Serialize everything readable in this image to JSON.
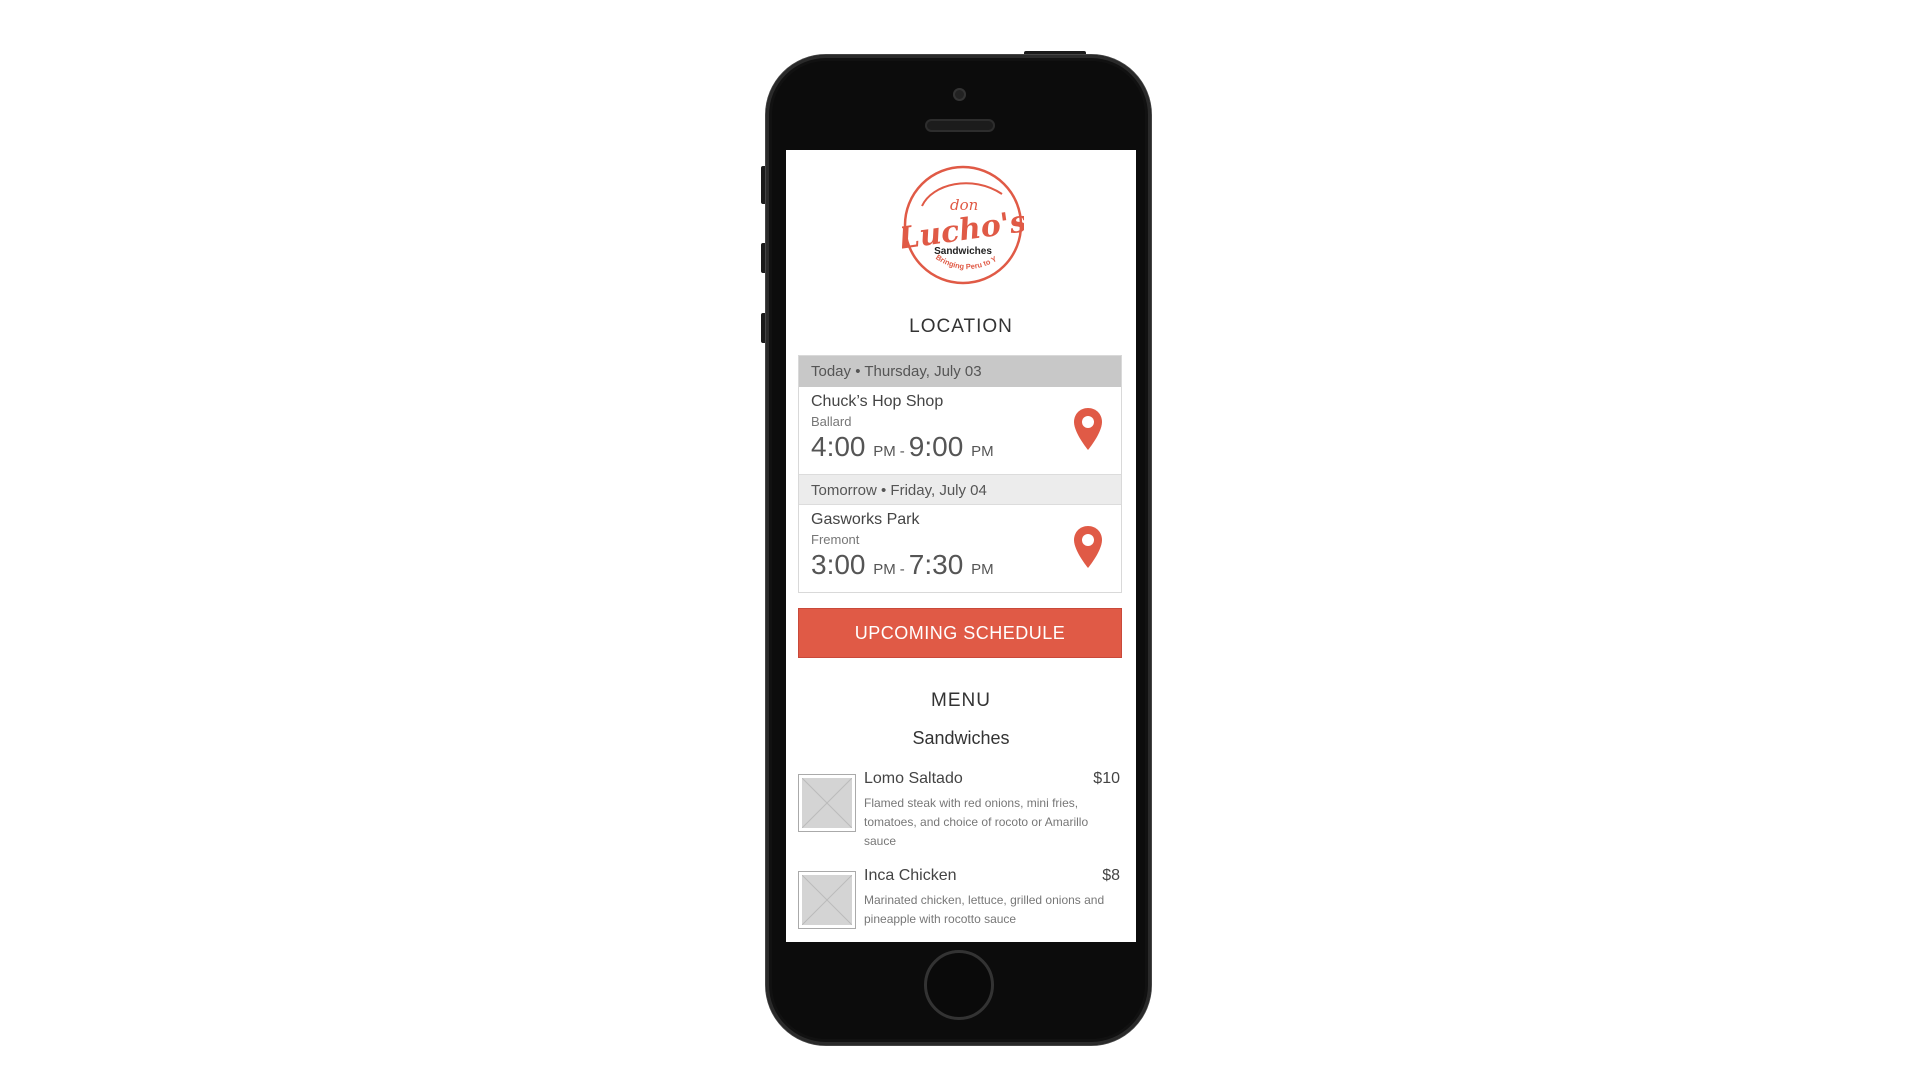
{
  "brand": {
    "logo_top": "don",
    "logo_main": "Lucho's",
    "logo_sub": "Sandwiches",
    "logo_tagline": "Bringing Peru to You",
    "accent_color": "#e05a46"
  },
  "location": {
    "title": "LOCATION",
    "days": [
      {
        "header": "Today • Thursday, July 03",
        "place": "Chuck’s Hop Shop",
        "area": "Ballard",
        "start": "4:00",
        "start_ampm": "PM",
        "end": "9:00",
        "end_ampm": "PM",
        "icon": "map-pin-icon"
      },
      {
        "header": "Tomorrow • Friday, July 04",
        "place": "Gasworks Park",
        "area": "Fremont",
        "start": "3:00",
        "start_ampm": "PM",
        "end": "7:30",
        "end_ampm": "PM",
        "icon": "map-pin-icon"
      }
    ],
    "separator": "-"
  },
  "upcoming_button": "UPCOMING SCHEDULE",
  "menu": {
    "title": "MENU",
    "category": "Sandwiches",
    "items": [
      {
        "name": "Lomo Saltado",
        "price": "$10",
        "description": "Flamed steak with red onions, mini fries, tomatoes, and choice of rocoto or Amarillo sauce",
        "icon": "image-placeholder-icon"
      },
      {
        "name": "Inca Chicken",
        "price": "$8",
        "description": "Marinated chicken, lettuce, grilled onions and pineapple with rocotto sauce",
        "icon": "image-placeholder-icon"
      }
    ]
  }
}
